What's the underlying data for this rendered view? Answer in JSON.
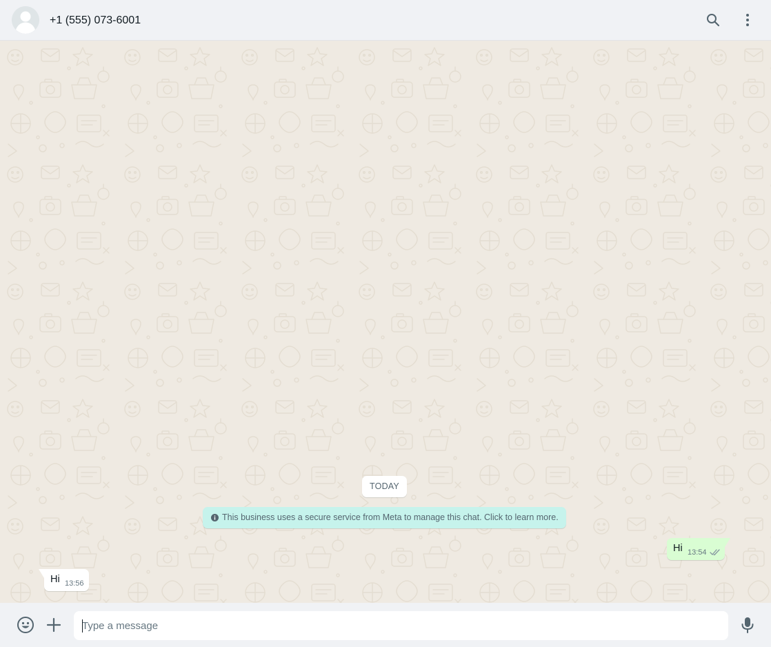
{
  "header": {
    "contact_name": "+1 (555) 073-6001",
    "avatar_icon": "default-user-avatar-icon",
    "search_icon": "search-icon",
    "menu_icon": "more-vertical-icon"
  },
  "chat": {
    "date_label": "TODAY",
    "system_message": "This business uses a secure service from Meta to manage this chat. Click to learn more.",
    "messages": [
      {
        "direction": "outgoing",
        "text": "Hi",
        "time": "13:54",
        "status": "read"
      },
      {
        "direction": "incoming",
        "text": "Hi",
        "time": "13:56"
      }
    ]
  },
  "footer": {
    "placeholder": "Type a message",
    "value": "",
    "emoji_icon": "emoji-icon",
    "attach_icon": "plus-icon",
    "mic_icon": "microphone-icon"
  },
  "colors": {
    "chat_background": "#efeae2",
    "outgoing_bubble": "#d9fdd3",
    "system_bubble": "#c6f3ec",
    "read_ticks": "#53bdeb",
    "panel": "#f0f2f5"
  }
}
